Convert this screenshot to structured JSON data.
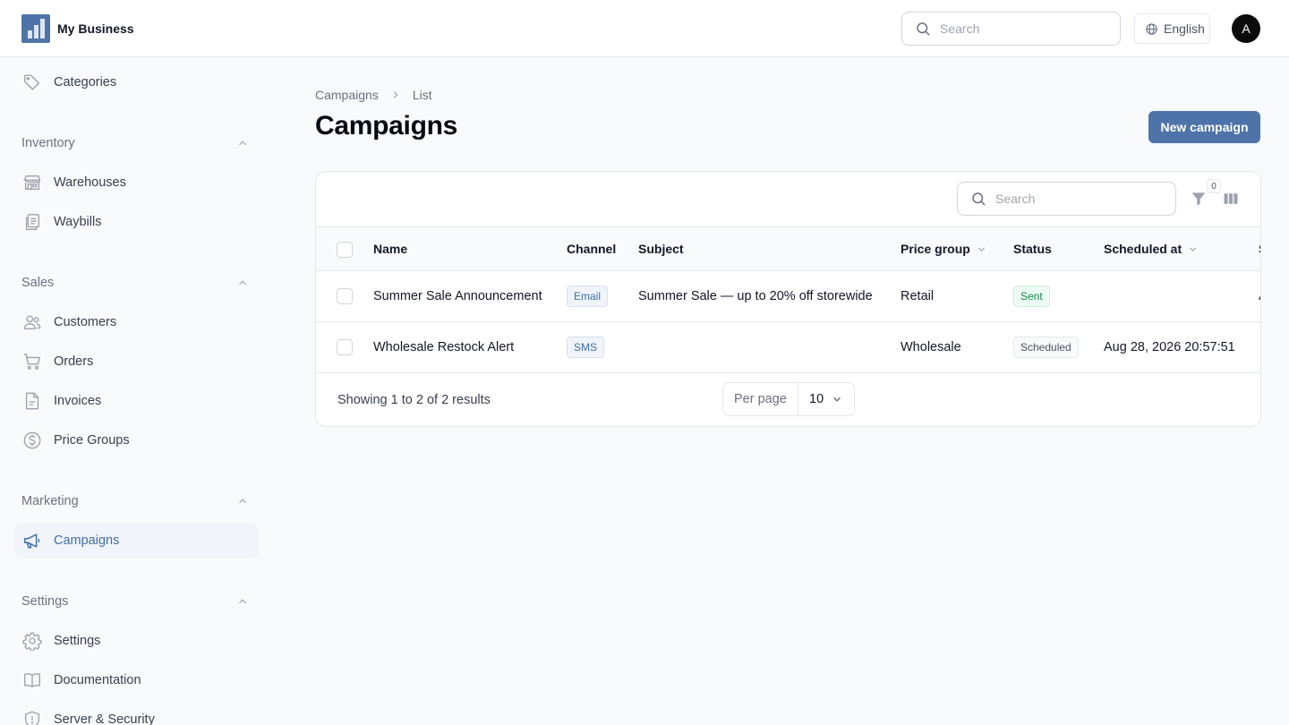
{
  "app": {
    "name": "My Business"
  },
  "header": {
    "search_placeholder": "Search",
    "language": "English",
    "avatar_initial": "A"
  },
  "sidebar": {
    "top_items": [
      {
        "label": "Categories",
        "icon": "tag-icon"
      }
    ],
    "groups": [
      {
        "title": "Inventory",
        "items": [
          {
            "label": "Warehouses",
            "icon": "building-storefront-icon"
          },
          {
            "label": "Waybills",
            "icon": "clipboard-document-list-icon"
          }
        ]
      },
      {
        "title": "Sales",
        "items": [
          {
            "label": "Customers",
            "icon": "users-icon"
          },
          {
            "label": "Orders",
            "icon": "shopping-cart-icon"
          },
          {
            "label": "Invoices",
            "icon": "document-icon"
          },
          {
            "label": "Price Groups",
            "icon": "currency-dollar-icon"
          }
        ]
      },
      {
        "title": "Marketing",
        "items": [
          {
            "label": "Campaigns",
            "icon": "megaphone-icon",
            "active": true
          }
        ]
      },
      {
        "title": "Settings",
        "items": [
          {
            "label": "Settings",
            "icon": "gear-icon"
          },
          {
            "label": "Documentation",
            "icon": "book-icon"
          },
          {
            "label": "Server & Security",
            "icon": "shield-icon"
          }
        ]
      }
    ]
  },
  "breadcrumb": [
    "Campaigns",
    "List"
  ],
  "page": {
    "title": "Campaigns",
    "new_button": "New campaign"
  },
  "table": {
    "search_placeholder": "Search",
    "filter_count": "0",
    "columns": {
      "name": "Name",
      "channel": "Channel",
      "subject": "Subject",
      "price_group": "Price group",
      "status": "Status",
      "scheduled_at": "Scheduled at",
      "next_truncated": "S"
    },
    "rows": [
      {
        "name": "Summer Sale Announcement",
        "channel": "Email",
        "subject": "Summer Sale — up to 20% off storewide",
        "price_group": "Retail",
        "status": "Sent",
        "scheduled_at": "",
        "next_truncated": "A"
      },
      {
        "name": "Wholesale Restock Alert",
        "channel": "SMS",
        "subject": "",
        "price_group": "Wholesale",
        "status": "Scheduled",
        "scheduled_at": "Aug 28, 2026 20:57:51",
        "next_truncated": ""
      }
    ],
    "footer": {
      "summary": "Showing 1 to 2 of 2 results",
      "per_page_label": "Per page",
      "per_page_value": "10"
    }
  },
  "colors": {
    "primary": "#4e73a8",
    "active_nav_bg": "#f1f4f8",
    "sent_green": "#17864a"
  }
}
